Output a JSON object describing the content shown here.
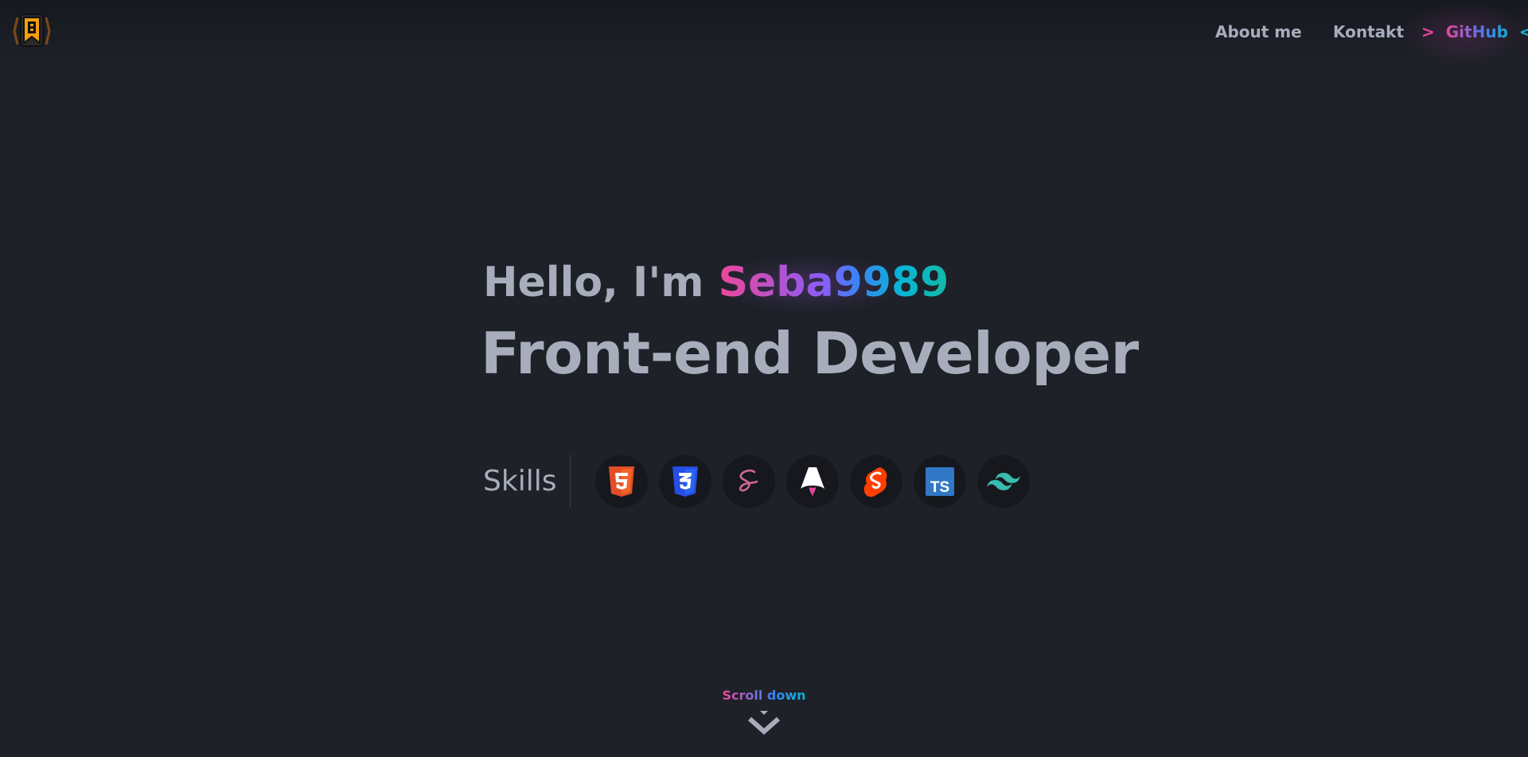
{
  "header": {
    "nav": {
      "about_label": "About me",
      "kontakt_label": "Kontakt",
      "github_label": "GitHub",
      "github_prefix": ">",
      "github_suffix": "<"
    }
  },
  "hero": {
    "greeting": "Hello, I'm ",
    "handle": "Seba9989",
    "role": "Front-end Developer"
  },
  "skills": {
    "label": "Skills",
    "items": [
      {
        "icon": "html5-icon",
        "color": "#e44d26"
      },
      {
        "icon": "css3-icon",
        "color": "#264de4"
      },
      {
        "icon": "sass-icon",
        "color": "#cd6799"
      },
      {
        "icon": "astro-icon",
        "color": "#ffffff"
      },
      {
        "icon": "svelte-icon",
        "color": "#ff3e00"
      },
      {
        "icon": "typescript-icon",
        "color": "#3178c6"
      },
      {
        "icon": "tailwind-icon",
        "color": "#38bdf8"
      }
    ]
  },
  "scroll": {
    "label": "Scroll down"
  },
  "colors": {
    "background": "#1e2128",
    "text": "#a7adbb",
    "gradient_start": "#ec4899",
    "gradient_mid": "#3b82f6",
    "gradient_end": "#06b6d4"
  }
}
